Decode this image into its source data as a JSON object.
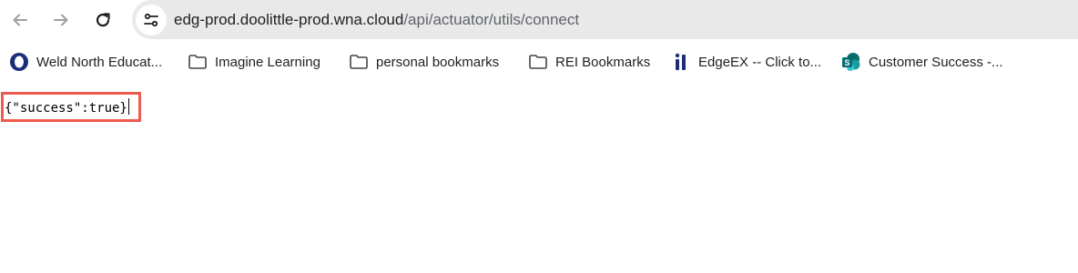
{
  "browser": {
    "url_host": "edg-prod.doolittle-prod.wna.cloud",
    "url_path": "/api/actuator/utils/connect"
  },
  "bookmarks": [
    {
      "label": "Weld North Educat...",
      "icon": "weld-north-logo-icon"
    },
    {
      "label": "Imagine Learning",
      "icon": "folder-icon"
    },
    {
      "label": "personal bookmarks",
      "icon": "folder-icon"
    },
    {
      "label": "REI Bookmarks",
      "icon": "folder-icon"
    },
    {
      "label": "EdgeEX -- Click to...",
      "icon": "edgeex-logo-icon"
    },
    {
      "label": "Customer Success -...",
      "icon": "sharepoint-icon"
    }
  ],
  "content": {
    "json_text": "{\"success\":true}"
  },
  "colors": {
    "highlight_border": "#ef5a4f",
    "omnibox_bg": "#e9e9e9"
  }
}
